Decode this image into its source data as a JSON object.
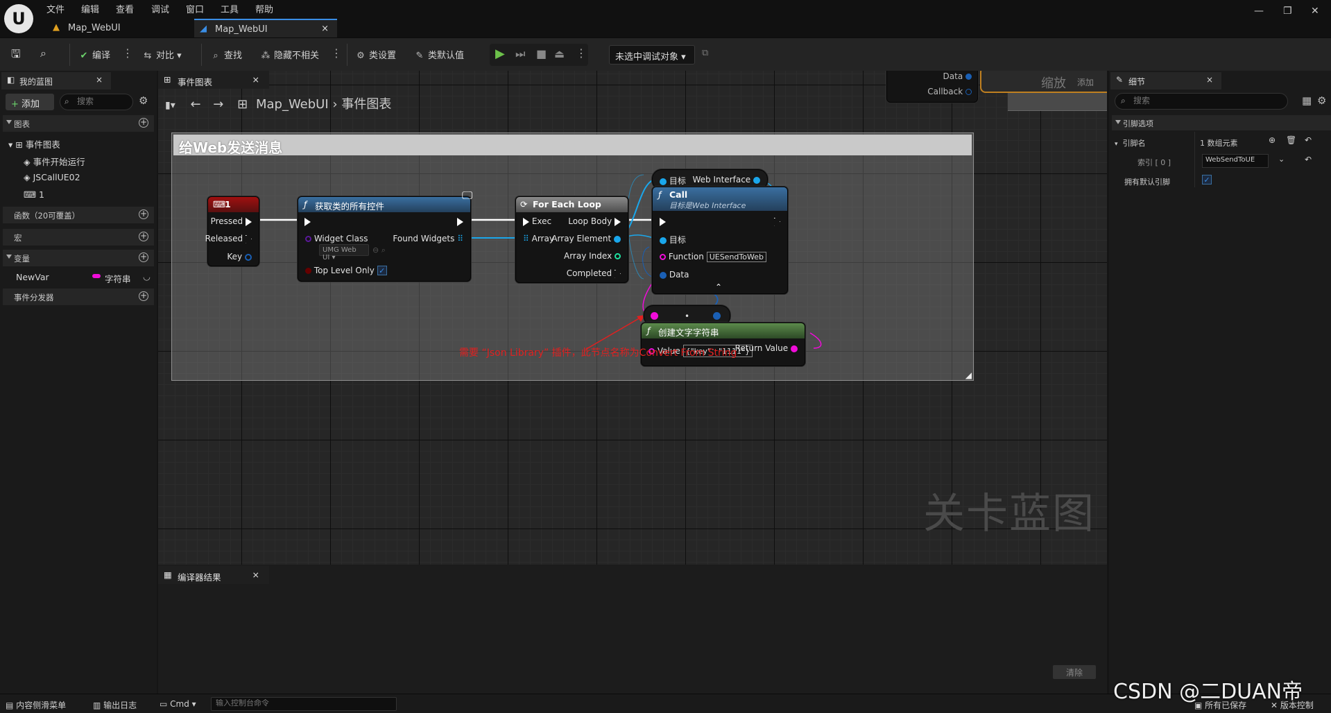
{
  "menu": {
    "items": [
      "文件",
      "编辑",
      "查看",
      "调试",
      "窗口",
      "工具",
      "帮助"
    ]
  },
  "tabs": [
    {
      "label": "Map_WebUI"
    },
    {
      "label": "Map_WebUI"
    }
  ],
  "toolbar": {
    "compile": "编译",
    "diff": "对比",
    "find": "查找",
    "hide_unrelated": "隐藏不相关",
    "class_settings": "类设置",
    "class_defaults": "类默认值",
    "debug_target": "未选中调试对象"
  },
  "left_panel": {
    "tab_label": "我的蓝图",
    "add_label": "添加",
    "search_placeholder": "搜索",
    "graphs_header": "图表",
    "event_graph": "事件图表",
    "events": [
      "事件开始运行",
      "JSCallUE02",
      "1"
    ],
    "functions_header": "函数（20可覆盖）",
    "macros_header": "宏",
    "variables_header": "变量",
    "variable_name": "NewVar",
    "variable_type": "字符串",
    "dispatchers_header": "事件分发器"
  },
  "graph": {
    "tab_label": "事件图表",
    "breadcrumb_root": "Map_WebUI",
    "breadcrumb_current": "事件图表",
    "comment_title": "给Web发送消息",
    "annotation": "需要 “Json Library” 插件，此节点名称为Convert From String",
    "watermark": "关卡蓝图",
    "zoom_label": "缩放",
    "zoom_suffix": "添加",
    "top_node": {
      "data": "Data",
      "callback": "Callback"
    },
    "node_key": {
      "title": "1",
      "pressed": "Pressed",
      "released": "Released",
      "key": "Key"
    },
    "node_getwidgets": {
      "title": "获取类的所有控件",
      "widget_class": "Widget Class",
      "widget_value": "UMG Web UI",
      "found": "Found Widgets",
      "top_level": "Top Level Only"
    },
    "node_foreach": {
      "title": "For Each Loop",
      "exec": "Exec",
      "array": "Array",
      "loop_body": "Loop Body",
      "array_element": "Array Element",
      "array_index": "Array Index",
      "completed": "Completed"
    },
    "node_cast": {
      "target": "目标",
      "web_interface": "Web Interface"
    },
    "node_call": {
      "title": "Call",
      "subtitle": "目标是Web Interface",
      "target": "目标",
      "function": "Function",
      "function_value": "UESendToWeb",
      "data": "Data"
    },
    "node_make": {
      "title": "创建文字字符串",
      "value": "Value",
      "value_text": "{\"key\"：\"1111\"}",
      "return": "Return Value"
    }
  },
  "compiler": {
    "tab_label": "编译器结果",
    "clear": "清除"
  },
  "details": {
    "tab_label": "细节",
    "search_placeholder": "搜索",
    "section": "引脚选项",
    "pin_names_label": "引脚名",
    "pin_names_value": "1 数组元素",
    "index_label": "索引 [ 0 ]",
    "index_value": "WebSendToUE",
    "default_pin_label": "拥有默认引脚"
  },
  "statusbar": {
    "content_drawer": "内容侧滑菜单",
    "output_log": "输出日志",
    "cmd": "Cmd",
    "console_placeholder": "输入控制台命令",
    "saved": "所有已保存",
    "version": "版本控制",
    "csdn": "CSDN @二DUAN帝"
  },
  "colors": {
    "accent": "#3a8ee6",
    "exec": "#ffffff",
    "string_pin": "#f00cd9",
    "object_pin": "#1aa7ec",
    "bool_pin": "#930000",
    "int_pin": "#1ee3a1",
    "annotation": "#e02020"
  }
}
